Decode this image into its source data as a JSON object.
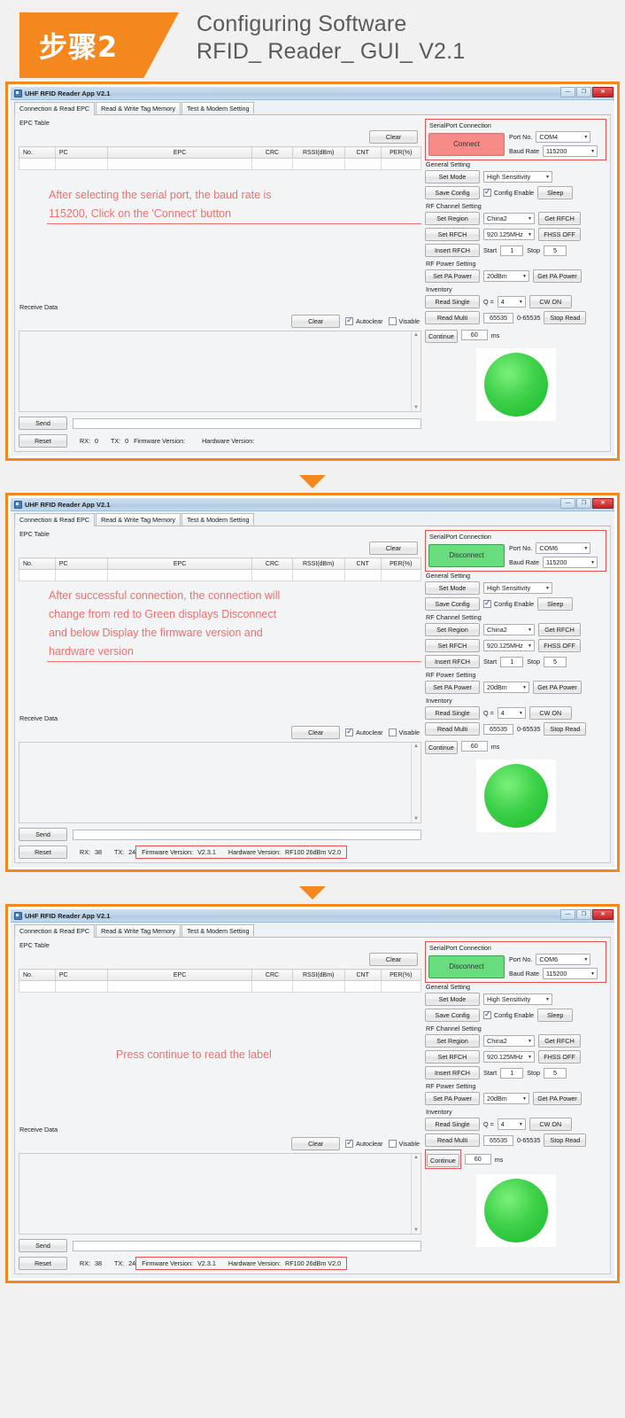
{
  "header": {
    "step_badge": "步骤2",
    "title_line1": "Configuring Software",
    "title_line2": "RFID_ Reader_ GUI_ V2.1"
  },
  "window": {
    "title": "UHF RFID Reader App V2.1",
    "btn_minimize": "—",
    "btn_maximize": "❐",
    "btn_close": "✕",
    "tabs": [
      "Connection & Read EPC",
      "Read & Write Tag Memory",
      "Test & Modem Setting"
    ]
  },
  "epc": {
    "group_label": "EPC Table",
    "clear_label": "Clear",
    "columns": [
      "No.",
      "PC",
      "EPC",
      "CRC",
      "RSSI(dBm)",
      "CNT",
      "PER(%)"
    ]
  },
  "receive": {
    "group_label": "Receive Data",
    "clear_label": "Clear",
    "autoclear_label": "Autoclear",
    "visable_label": "Visable",
    "send_label": "Send",
    "reset_label": "Reset",
    "rx_label": "RX:",
    "tx_label": "TX:",
    "firmware_label": "Firmware Version:",
    "hardware_label": "Hardware Version:"
  },
  "serial": {
    "group_label": "SerialPort Connection",
    "connect_label": "Connect",
    "disconnect_label": "Disconnect",
    "port_label": "Port No.",
    "baud_label": "Baud Rate",
    "baud_value": "115200"
  },
  "general": {
    "group_label": "General Setting",
    "set_mode": "Set Mode",
    "mode_value": "High Sensitivity",
    "save_config": "Save Config",
    "config_enable": "Config Enable",
    "sleep": "Sleep"
  },
  "rfchannel": {
    "group_label": "RF Channel Setting",
    "set_region": "Set Region",
    "region_value": "China2",
    "get_rfch": "Get RFCH",
    "set_rfch": "Set RFCH",
    "rfch_value": "920.125MHz",
    "fhss": "FHSS OFF",
    "insert_rfch": "Insert RFCH",
    "start_label": "Start",
    "start_value": "1",
    "stop_label": "Stop",
    "stop_value": "5"
  },
  "rfpower": {
    "group_label": "RF Power Setting",
    "set_pa": "Set PA Power",
    "pa_value": "20dBm",
    "get_pa": "Get PA Power"
  },
  "inventory": {
    "group_label": "Inventory",
    "read_single": "Read Single",
    "q_label": "Q =",
    "q_value": "4",
    "cw_on": "CW ON",
    "read_multi": "Read Multi",
    "multi_value": "65535",
    "multi_range": "0-65535",
    "stop_read": "Stop Read",
    "continue": "Continue",
    "continue_value": "60",
    "ms_label": "ms"
  },
  "steps": [
    {
      "id": "step1",
      "port_value": "COM4",
      "connect_state": "Connect",
      "connect_color": "#f58a87",
      "rx_value": "0",
      "tx_value": "0",
      "firmware_value": "",
      "hardware_value": "",
      "firmware_highlight": false,
      "continue_highlight": false,
      "annotation": [
        "After selecting the serial port, the baud rate is",
        "115200, Click on the 'Connect' button"
      ]
    },
    {
      "id": "step2",
      "port_value": "COM6",
      "connect_state": "Disconnect",
      "connect_color": "#67dd7e",
      "rx_value": "38",
      "tx_value": "24",
      "firmware_value": "V2.3.1",
      "hardware_value": "RF100 26dBm V2.0",
      "firmware_highlight": true,
      "continue_highlight": false,
      "annotation": [
        "After successful connection, the connection will",
        "change from red to Green displays Disconnect",
        "and below Display the firmware version and",
        "hardware version"
      ]
    },
    {
      "id": "step3",
      "port_value": "COM6",
      "connect_state": "Disconnect",
      "connect_color": "#67dd7e",
      "rx_value": "38",
      "tx_value": "24",
      "firmware_value": "V2.3.1",
      "hardware_value": "RF100 26dBm V2.0",
      "firmware_highlight": true,
      "continue_highlight": true,
      "annotation": [
        "Press continue to read the label"
      ]
    }
  ],
  "colors": {
    "accent_orange": "#f5871f",
    "annotation_red": "#f0706e",
    "highlight_red": "#e8524e",
    "led_green": "#3fd14a",
    "connect_red": "#f58a87"
  }
}
